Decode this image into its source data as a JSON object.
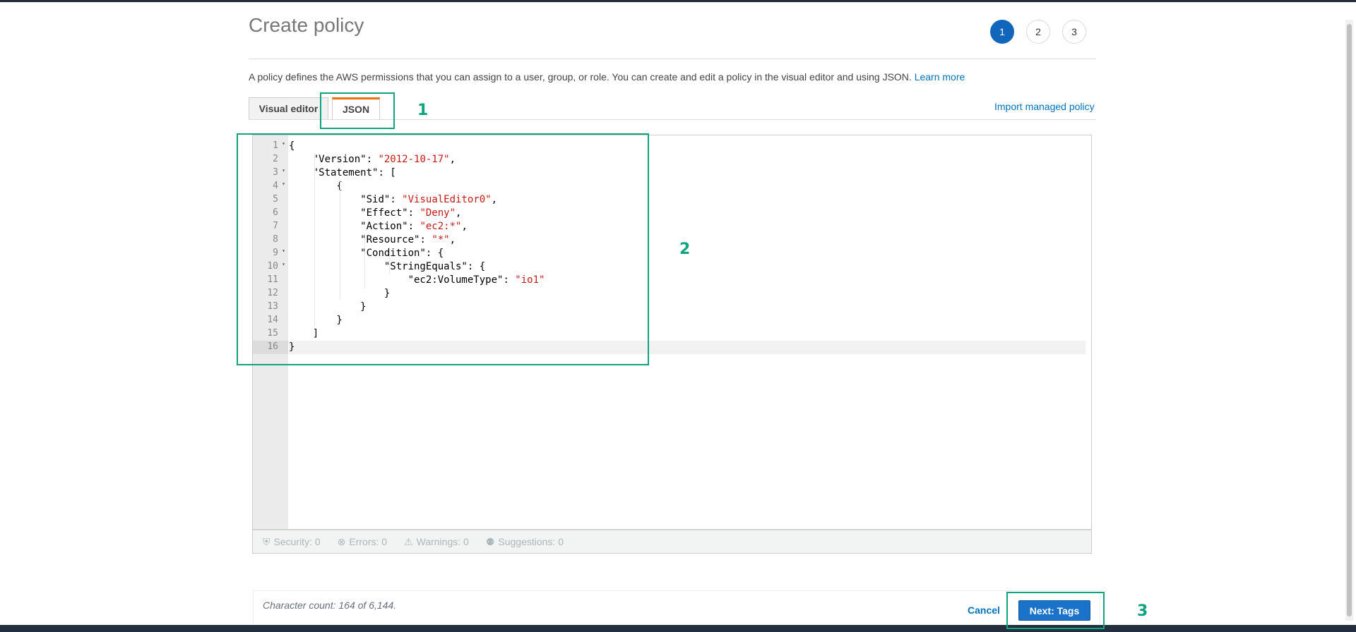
{
  "page": {
    "title": "Create policy"
  },
  "steps": [
    "1",
    "2",
    "3"
  ],
  "description": {
    "text": "A policy defines the AWS permissions that you can assign to a user, group, or role. You can create and edit a policy in the visual editor and using JSON.",
    "link": "Learn more"
  },
  "tabs": {
    "visual": "Visual editor",
    "json": "JSON"
  },
  "import_link": "Import managed policy",
  "editor": {
    "line_numbers": [
      "1",
      "2",
      "3",
      "4",
      "5",
      "6",
      "7",
      "8",
      "9",
      "10",
      "11",
      "12",
      "13",
      "14",
      "15",
      "16"
    ],
    "lines": [
      "{",
      "    \"Version\": \"2012-10-17\",",
      "    \"Statement\": [",
      "        {",
      "            \"Sid\": \"VisualEditor0\",",
      "            \"Effect\": \"Deny\",",
      "            \"Action\": \"ec2:*\",",
      "            \"Resource\": \"*\",",
      "            \"Condition\": {",
      "                \"StringEquals\": {",
      "                    \"ec2:VolumeType\": \"io1\"",
      "                }",
      "            }",
      "        }",
      "    ]",
      "}"
    ]
  },
  "status": {
    "security": "Security: 0",
    "errors": "Errors: 0",
    "warnings": "Warnings: 0",
    "suggestions": "Suggestions: 0"
  },
  "footer": {
    "char_count": "Character count: 164 of 6,144.",
    "cancel": "Cancel",
    "next": "Next: Tags"
  },
  "annotations": [
    "1",
    "2",
    "3"
  ],
  "colors": {
    "accent": "#1166bb",
    "annotation": "#10a37f",
    "tab_accent": "#ec7211",
    "string": "#c41a16"
  }
}
